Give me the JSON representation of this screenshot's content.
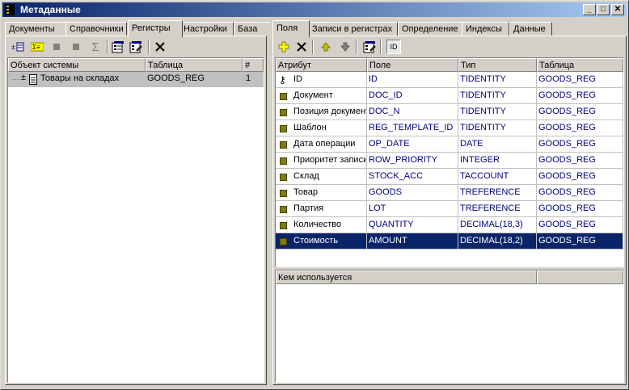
{
  "window": {
    "title": "Метаданные",
    "icon": "app-icon"
  },
  "left": {
    "tabs": [
      "Документы",
      "Справочники",
      "Регистры",
      "Настройки",
      "База"
    ],
    "active_tab": 2,
    "columns": [
      "Объект системы",
      "Таблица",
      "#"
    ],
    "rows": [
      {
        "name": "Товары на складах",
        "table": "GOODS_REG",
        "num": "1"
      }
    ]
  },
  "right": {
    "tabs": [
      "Поля",
      "Записи в регистрах",
      "Определение",
      "Индексы",
      "Данные"
    ],
    "active_tab": 0,
    "columns": [
      "Атрибут",
      "Поле",
      "Тип",
      "Таблица"
    ],
    "rows": [
      {
        "attr": "ID",
        "field": "ID",
        "type": "TIDENTITY",
        "table": "GOODS_REG",
        "key": true
      },
      {
        "attr": "Документ",
        "field": "DOC_ID",
        "type": "TIDENTITY",
        "table": "GOODS_REG"
      },
      {
        "attr": "Позиция документа",
        "field": "DOC_N",
        "type": "TIDENTITY",
        "table": "GOODS_REG"
      },
      {
        "attr": "Шаблон",
        "field": "REG_TEMPLATE_ID",
        "type": "TIDENTITY",
        "table": "GOODS_REG"
      },
      {
        "attr": "Дата операции",
        "field": "OP_DATE",
        "type": "DATE",
        "table": "GOODS_REG"
      },
      {
        "attr": "Приоритет записи",
        "field": "ROW_PRIORITY",
        "type": "INTEGER",
        "table": "GOODS_REG"
      },
      {
        "attr": "Склад",
        "field": "STOCK_ACC",
        "type": "TACCOUNT",
        "table": "GOODS_REG"
      },
      {
        "attr": "Товар",
        "field": "GOODS",
        "type": "TREFERENCE",
        "table": "GOODS_REG"
      },
      {
        "attr": "Партия",
        "field": "LOT",
        "type": "TREFERENCE",
        "table": "GOODS_REG"
      },
      {
        "attr": "Количество",
        "field": "QUANTITY",
        "type": "DECIMAL(18,3)",
        "table": "GOODS_REG"
      },
      {
        "attr": "Стоимость",
        "field": "AMOUNT",
        "type": "DECIMAL(18,2)",
        "table": "GOODS_REG",
        "selected": true
      }
    ],
    "used_by": {
      "header": "Кем используется"
    }
  },
  "colors": {
    "selection": "#0a246a",
    "field_text": "#000080",
    "bullet": "#808000"
  }
}
